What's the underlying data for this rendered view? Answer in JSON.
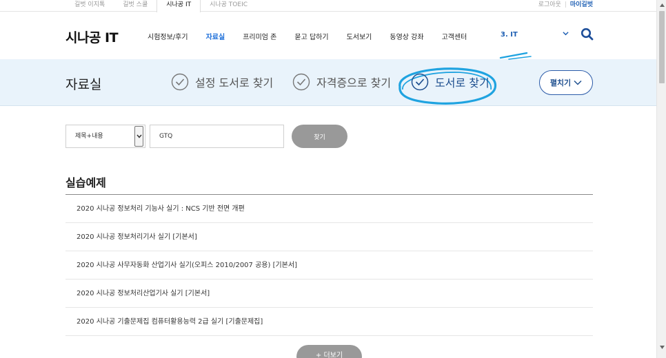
{
  "topbar": {
    "site_tabs": [
      {
        "label": "길벗 이지톡",
        "active": false
      },
      {
        "label": "길벗 스쿨",
        "active": false
      },
      {
        "label": "시나공 IT",
        "active": true
      },
      {
        "label": "시나공 TOEIC",
        "active": false
      }
    ],
    "logout": "로그아웃",
    "mypage": "마이길벗"
  },
  "header": {
    "logo": "시나공 IT",
    "nav": [
      {
        "label": "시험정보/후기",
        "active": false
      },
      {
        "label": "자료실",
        "active": true
      },
      {
        "label": "프리미엄 존",
        "active": false
      },
      {
        "label": "묻고 답하기",
        "active": false
      },
      {
        "label": "도서보기",
        "active": false
      },
      {
        "label": "동영상 강좌",
        "active": false
      },
      {
        "label": "고객센터",
        "active": false
      }
    ],
    "category": "3. IT",
    "category_icon": "chevron-down-icon",
    "search_icon": "search-icon"
  },
  "banner": {
    "title": "자료실",
    "shortcuts": [
      {
        "label": "설정 도서로 찾기",
        "active": false
      },
      {
        "label": "자격증으로 찾기",
        "active": false
      },
      {
        "label": "도서로 찾기",
        "active": true
      }
    ],
    "expand_label": "펼치기",
    "highlight_color": "#1fa3e0"
  },
  "search": {
    "select_value": "제목+내용",
    "query": "GTQ",
    "button_label": "찾기"
  },
  "section": {
    "title": "실습예제",
    "items": [
      "2020 시나공 정보처리 기능사 실기 : NCS 기반 전면 개편",
      "2020 시나공 정보처리기사 실기 [기본서]",
      "2020 시나공 사무자동화 산업기사 실기(오피스 2010/2007 공용) [기본서]",
      "2020 시나공 정보처리산업기사 실기 [기본서]",
      "2020 시나공 기출문제집 컴퓨터활용능력 2급 실기 [기출문제집]"
    ],
    "more_label": "+ 더보기"
  }
}
